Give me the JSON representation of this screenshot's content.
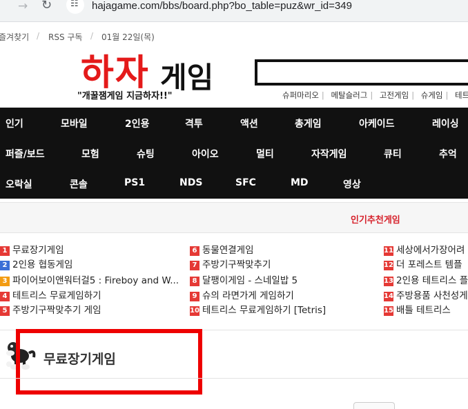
{
  "browser": {
    "url": "hajagame.com/bbs/board.php?bo_table=puz&wr_id=349",
    "back_glyph": "←",
    "forward_glyph": "→",
    "reload_glyph": "↻",
    "site_info_glyph": "☷"
  },
  "top_util": {
    "bookmark": "즐겨찾기",
    "rss": "RSS 구독",
    "date": "01월 22일(목)",
    "sep": "/"
  },
  "logo": {
    "red": "하자",
    "black": "게임"
  },
  "slogan": "\"개꿀잼게임 지금하자!!\"",
  "quick_links": [
    "슈퍼마리오",
    "메탈슬러그",
    "고전게임",
    "슈게임",
    "테트리스"
  ],
  "quick_sep": "|",
  "categories": [
    "인기",
    "모바일",
    "2인용",
    "격투",
    "액션",
    "총게임",
    "아케이드",
    "레이싱",
    "퍼즐/보드",
    "모험",
    "슈팅",
    "아이오",
    "멀티",
    "자작게임",
    "큐티",
    "추억",
    "오락실",
    "콘솔",
    "PS1",
    "NDS",
    "SFC",
    "MD",
    "영상"
  ],
  "recommend_title": "인기추천게임",
  "popular": [
    {
      "n": "1",
      "label": "무료장기게임"
    },
    {
      "n": "2",
      "label": "2인용 협동게임"
    },
    {
      "n": "3",
      "label": "파이어보이앤워터걸5 : Fireboy and W..."
    },
    {
      "n": "4",
      "label": "테트리스 무료게임하기"
    },
    {
      "n": "5",
      "label": "주방기구짝맞추기 게임"
    },
    {
      "n": "6",
      "label": "동물연결게임"
    },
    {
      "n": "7",
      "label": "주방기구짝맞추기"
    },
    {
      "n": "8",
      "label": "달팽이게임 - 스네일밥 5"
    },
    {
      "n": "9",
      "label": "슈의 라면가게 게임하기"
    },
    {
      "n": "10",
      "label": "테트리스 무료게임하기 [Tetris]"
    },
    {
      "n": "11",
      "label": "세상에서가장어려"
    },
    {
      "n": "12",
      "label": "더 포레스트 템플"
    },
    {
      "n": "13",
      "label": "2인용 테트리스 플"
    },
    {
      "n": "14",
      "label": "주방용품 사천성게"
    },
    {
      "n": "15",
      "label": "배틀 테트리스"
    }
  ],
  "board_title": "무료장기게임",
  "colors": {
    "accent_red": "#e41a1a",
    "nav_bg": "#111111",
    "highlight": "#ee0000"
  }
}
